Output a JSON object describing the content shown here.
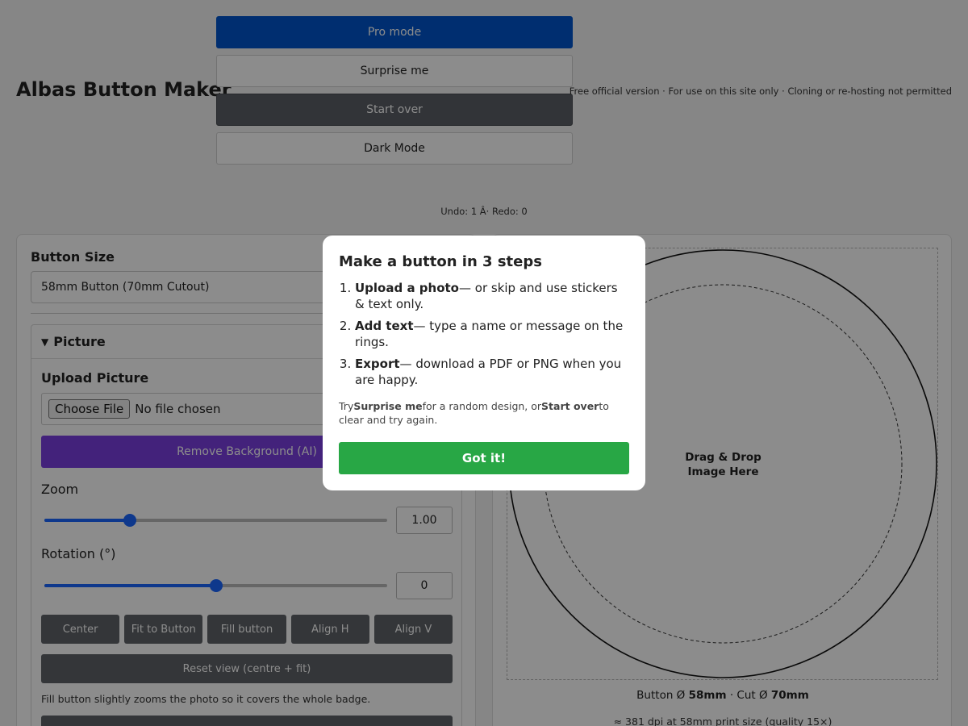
{
  "header": {
    "title": "Albas Button Maker",
    "notice": "Free official version · For use on this site only · Cloning or re-hosting not permitted",
    "buttons": {
      "pro_mode": "Pro mode",
      "surprise_me": "Surprise me",
      "start_over": "Start over",
      "dark_mode": "Dark Mode"
    },
    "undo_redo": "Undo: 1 Â· Redo: 0"
  },
  "left_panel": {
    "size_label": "Button Size",
    "size_selected": "58mm Button (70mm Cutout)",
    "picture_section": {
      "title": "Picture",
      "upload_label": "Upload Picture",
      "choose_file": "Choose File",
      "file_status": "No file chosen",
      "remove_bg": "Remove Background (AI)",
      "zoom_label": "Zoom",
      "zoom_value": "1.00",
      "zoom_fraction": 0.25,
      "rotation_label": "Rotation (°)",
      "rotation_value": "0",
      "rotation_fraction": 0.5,
      "align_buttons": [
        "Center",
        "Fit to Button",
        "Fill button",
        "Align H",
        "Align V"
      ],
      "reset_view": "Reset view (centre + fit)",
      "hint": "Fill button slightly zooms the photo so it covers the whole badge."
    }
  },
  "right_panel": {
    "drop_line1": "Drag & Drop",
    "drop_line2": "Image Here",
    "size_info_prefix": "Button Ø ",
    "button_size": "58mm",
    "size_info_mid": " · Cut Ø ",
    "cut_size": "70mm",
    "dpi_info": "≈ 381 dpi at 58mm print size (quality 15×)"
  },
  "modal": {
    "title": "Make a button in 3 steps",
    "steps": [
      {
        "bold": "Upload a photo",
        "text": "— or skip and use stickers & text only."
      },
      {
        "bold": "Add text",
        "text": "— type a name or message on the rings."
      },
      {
        "bold": "Export",
        "text": "— download a PDF or PNG when you are happy."
      }
    ],
    "foot_try": "Try",
    "foot_surprise": "Surprise me",
    "foot_mid": "for a random design, or",
    "foot_start": "Start over",
    "foot_end": "to clear and try again.",
    "got_it": "Got it!"
  }
}
